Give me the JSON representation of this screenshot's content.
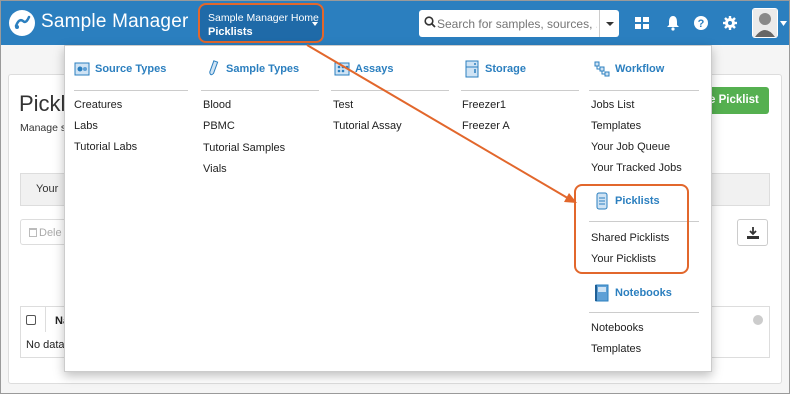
{
  "app": {
    "brand": "Sample Manager"
  },
  "nav": {
    "line1": "Sample Manager Home",
    "line2": "Picklists"
  },
  "search": {
    "placeholder": "Search for samples, sources, ..."
  },
  "page": {
    "title": "Pickl",
    "subtitle": "Manage s",
    "create_button": "e Picklist",
    "tab": "Your",
    "delete_button": "Dele",
    "table_header": "Na",
    "no_data": "No data"
  },
  "menu": {
    "columns": [
      {
        "title": "Source Types",
        "icon": "source-types-icon",
        "items": [
          "Creatures",
          "Labs",
          "Tutorial Labs"
        ]
      },
      {
        "title": "Sample Types",
        "icon": "sample-types-icon",
        "items": [
          "Blood",
          "PBMC",
          "Tutorial Samples",
          "Vials"
        ]
      },
      {
        "title": "Assays",
        "icon": "assays-icon",
        "items": [
          "Test",
          "Tutorial Assay"
        ]
      },
      {
        "title": "Storage",
        "icon": "storage-icon",
        "items": [
          "Freezer1",
          "Freezer A"
        ]
      },
      {
        "title": "Workflow",
        "icon": "workflow-icon",
        "items": [
          "Jobs List",
          "Templates",
          "Your Job Queue",
          "Your Tracked Jobs"
        ]
      }
    ],
    "picklists": {
      "title": "Picklists",
      "icon": "picklists-icon",
      "items": [
        "Shared Picklists",
        "Your Picklists"
      ]
    },
    "notebooks": {
      "title": "Notebooks",
      "icon": "notebooks-icon",
      "items": [
        "Notebooks",
        "Templates"
      ]
    }
  },
  "colors": {
    "header": "#2b7fbf",
    "accent": "#e2672c",
    "link": "#2b7fbf",
    "create": "#55b050"
  }
}
